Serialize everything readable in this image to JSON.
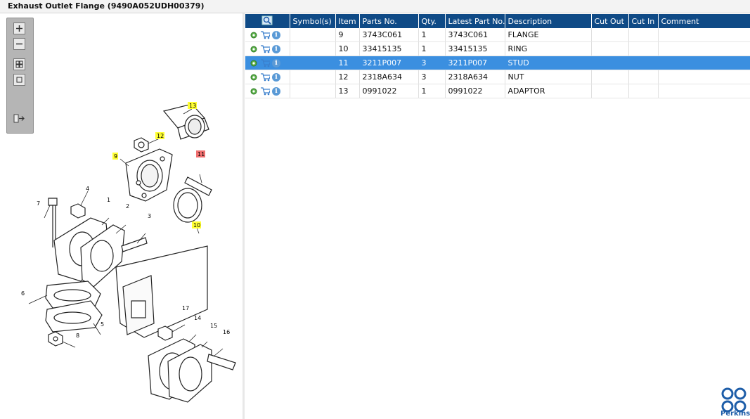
{
  "window": {
    "title": "Exhaust Outlet Flange (9490A052UDH00379)"
  },
  "toolbar": {
    "buttons": [
      {
        "name": "zoom-in-button",
        "icon": "plus-icon"
      },
      {
        "name": "zoom-out-button",
        "icon": "minus-icon"
      },
      {
        "name": "fit-page-button",
        "icon": "fit-page-icon"
      },
      {
        "name": "actual-size-button",
        "icon": "actual-size-icon"
      },
      {
        "name": "export-button",
        "icon": "export-icon"
      }
    ]
  },
  "diagram": {
    "callouts": [
      "13",
      "12",
      "9",
      "11",
      "10",
      "4",
      "1",
      "2",
      "3",
      "7",
      "6",
      "5",
      "8",
      "17",
      "14",
      "15",
      "16"
    ],
    "highlighted_callout": "11"
  },
  "grid": {
    "columns": [
      "Symbol(s)",
      "Item",
      "Parts No.",
      "Qty.",
      "Latest Part No.",
      "Description",
      "Cut Out",
      "Cut In",
      "Comment"
    ],
    "rows": [
      {
        "item": "9",
        "part_no": "3743C061",
        "qty": "1",
        "latest": "3743C061",
        "desc": "FLANGE",
        "cut_out": "",
        "cut_in": "",
        "comment": ""
      },
      {
        "item": "10",
        "part_no": "33415135",
        "qty": "1",
        "latest": "33415135",
        "desc": "RING",
        "cut_out": "",
        "cut_in": "",
        "comment": ""
      },
      {
        "item": "11",
        "part_no": "3211P007",
        "qty": "3",
        "latest": "3211P007",
        "desc": "STUD",
        "cut_out": "",
        "cut_in": "",
        "comment": ""
      },
      {
        "item": "12",
        "part_no": "2318A634",
        "qty": "3",
        "latest": "2318A634",
        "desc": "NUT",
        "cut_out": "",
        "cut_in": "",
        "comment": ""
      },
      {
        "item": "13",
        "part_no": "0991022",
        "qty": "1",
        "latest": "0991022",
        "desc": "ADAPTOR",
        "cut_out": "",
        "cut_in": "",
        "comment": ""
      }
    ],
    "selected_row_index": 2,
    "row_icons": [
      "gear-icon",
      "cart-icon",
      "info-icon"
    ]
  },
  "brand": {
    "name": "Perkins",
    "color": "#1d5da8"
  },
  "colors": {
    "header": "#0f4a86",
    "selected": "#3b8fe0",
    "callout_yellow": "#ffff33",
    "callout_red": "#f07070"
  }
}
